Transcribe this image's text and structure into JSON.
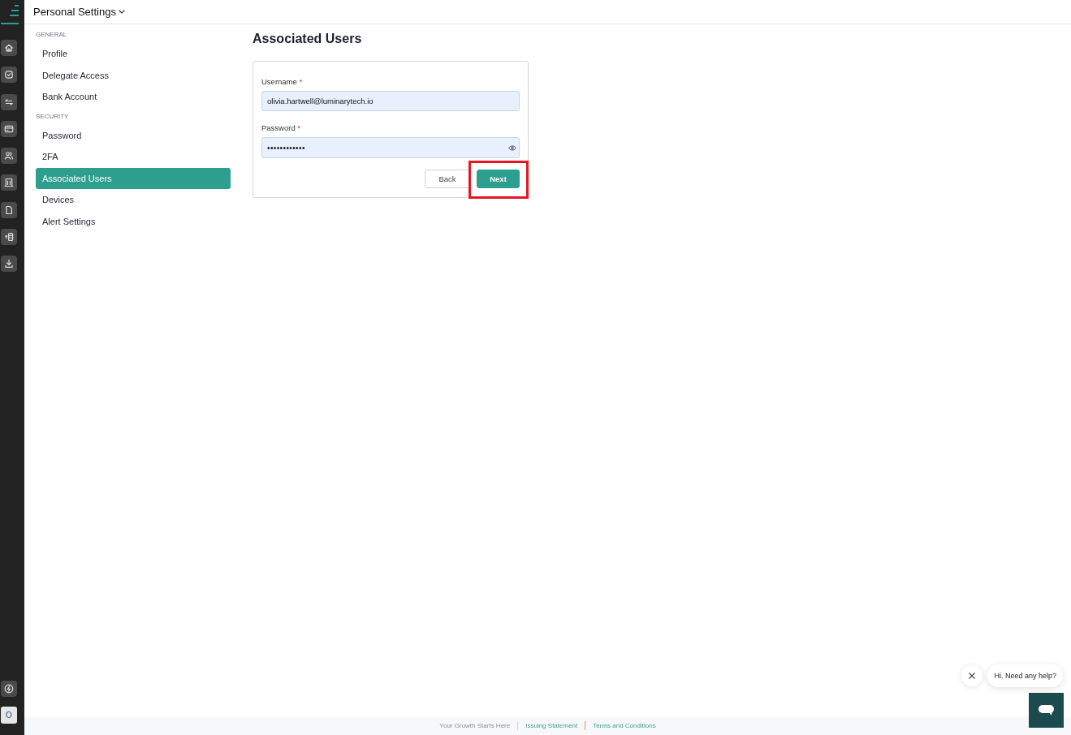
{
  "header": {
    "title": "Personal Settings"
  },
  "rail": {
    "avatar_initial": "O"
  },
  "sidebar": {
    "sections": [
      {
        "heading": "GENERAL",
        "items": [
          {
            "label": "Profile",
            "selected": false
          },
          {
            "label": "Delegate Access",
            "selected": false
          },
          {
            "label": "Bank Account",
            "selected": false
          }
        ]
      },
      {
        "heading": "SECURITY",
        "items": [
          {
            "label": "Password",
            "selected": false
          },
          {
            "label": "2FA",
            "selected": false
          },
          {
            "label": "Associated Users",
            "selected": true
          },
          {
            "label": "Devices",
            "selected": false
          },
          {
            "label": "Alert Settings",
            "selected": false
          }
        ]
      }
    ]
  },
  "page": {
    "title": "Associated Users"
  },
  "form": {
    "fields": [
      {
        "kind": "text",
        "label": "Username",
        "required_mark": "*",
        "value": "olivia.hartwell@luminarytech.io"
      },
      {
        "kind": "password",
        "label": "Password",
        "required_mark": "*",
        "value": "••••••••••••"
      }
    ],
    "buttons": [
      {
        "kind": "secondary",
        "label": "Back",
        "highlighted": false
      },
      {
        "kind": "primary",
        "label": "Next",
        "highlighted": true
      }
    ]
  },
  "footer": {
    "links": [
      {
        "kind": "text",
        "label": "Your Growth Starts Here"
      },
      {
        "kind": "link",
        "label": "Issuing Statement"
      },
      {
        "kind": "link",
        "label": "Terms and Conditions"
      }
    ]
  },
  "chat": {
    "greeting": "Hi. Need any help?"
  }
}
